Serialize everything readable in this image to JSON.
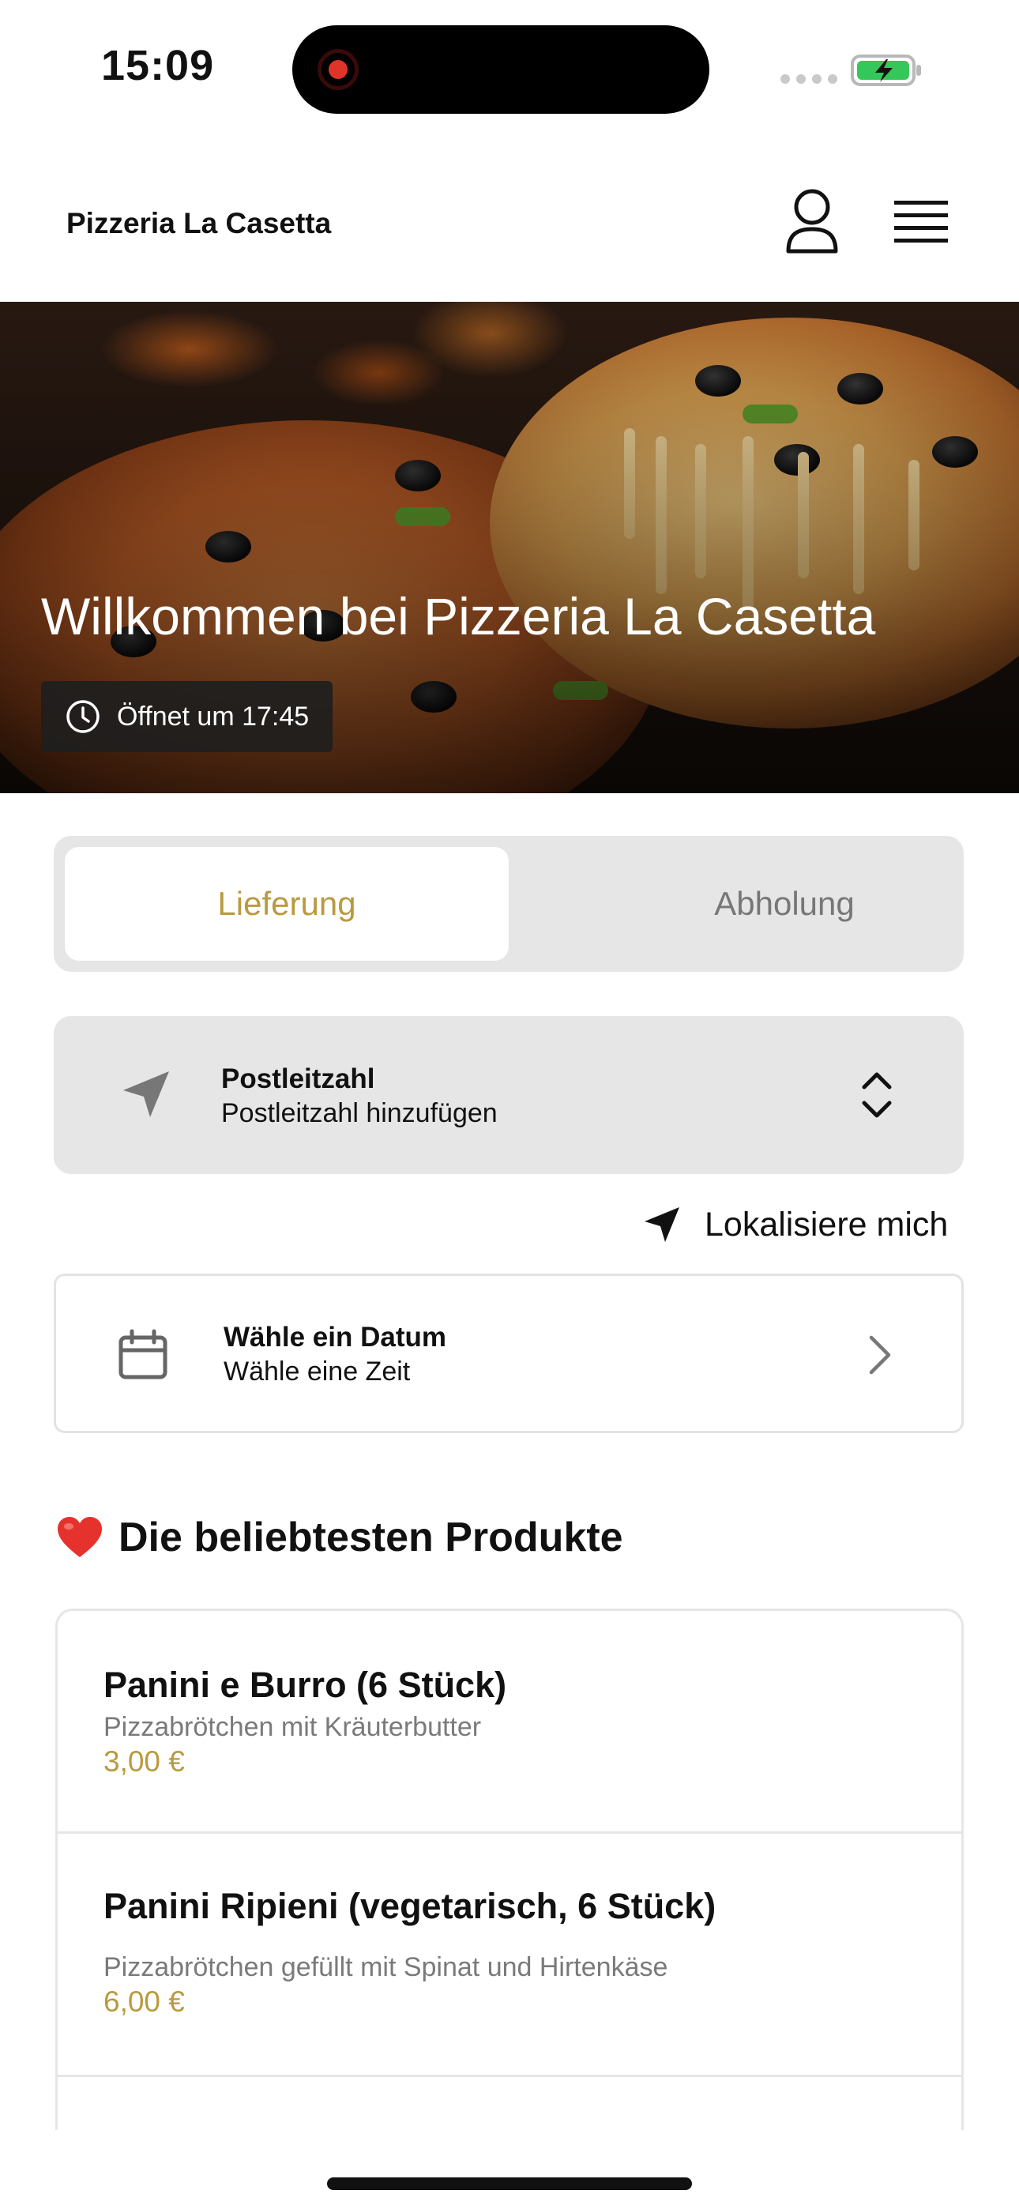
{
  "status_bar": {
    "time": "15:09"
  },
  "header": {
    "brand": "Pizzeria La Casetta"
  },
  "hero": {
    "title": "Willkommen bei Pizzeria La Casetta",
    "opening_text": "Öffnet um 17:45"
  },
  "mode_toggle": {
    "tabs": [
      {
        "label": "Lieferung",
        "active": true
      },
      {
        "label": "Abholung",
        "active": false
      }
    ]
  },
  "postcode": {
    "title": "Postleitzahl",
    "placeholder": "Postleitzahl hinzufügen"
  },
  "locate": {
    "label": "Lokalisiere mich"
  },
  "date": {
    "title": "Wähle ein Datum",
    "subtitle": "Wähle eine Zeit"
  },
  "popular": {
    "title": "Die beliebtesten Produkte",
    "products": [
      {
        "name": "Panini e Burro (6 Stück)",
        "description": "Pizzabrötchen mit Kräuterbutter",
        "price": "3,00 €"
      },
      {
        "name": "Panini Ripieni (vegetarisch, 6 Stück)",
        "description": "Pizzabrötchen gefüllt mit Spinat und Hirtenkäse",
        "price": "6,00 €"
      }
    ]
  },
  "colors": {
    "accent": "#b99a3e",
    "toggle_bg": "#e6e6e6",
    "battery_green": "#34c759"
  },
  "icons": [
    "record-icon",
    "battery-icon",
    "user-icon",
    "menu-icon",
    "clock-icon",
    "navigation-arrow-icon",
    "chevron-up-down-icon",
    "locate-arrow-icon",
    "calendar-icon",
    "chevron-right-icon",
    "heart-icon"
  ]
}
